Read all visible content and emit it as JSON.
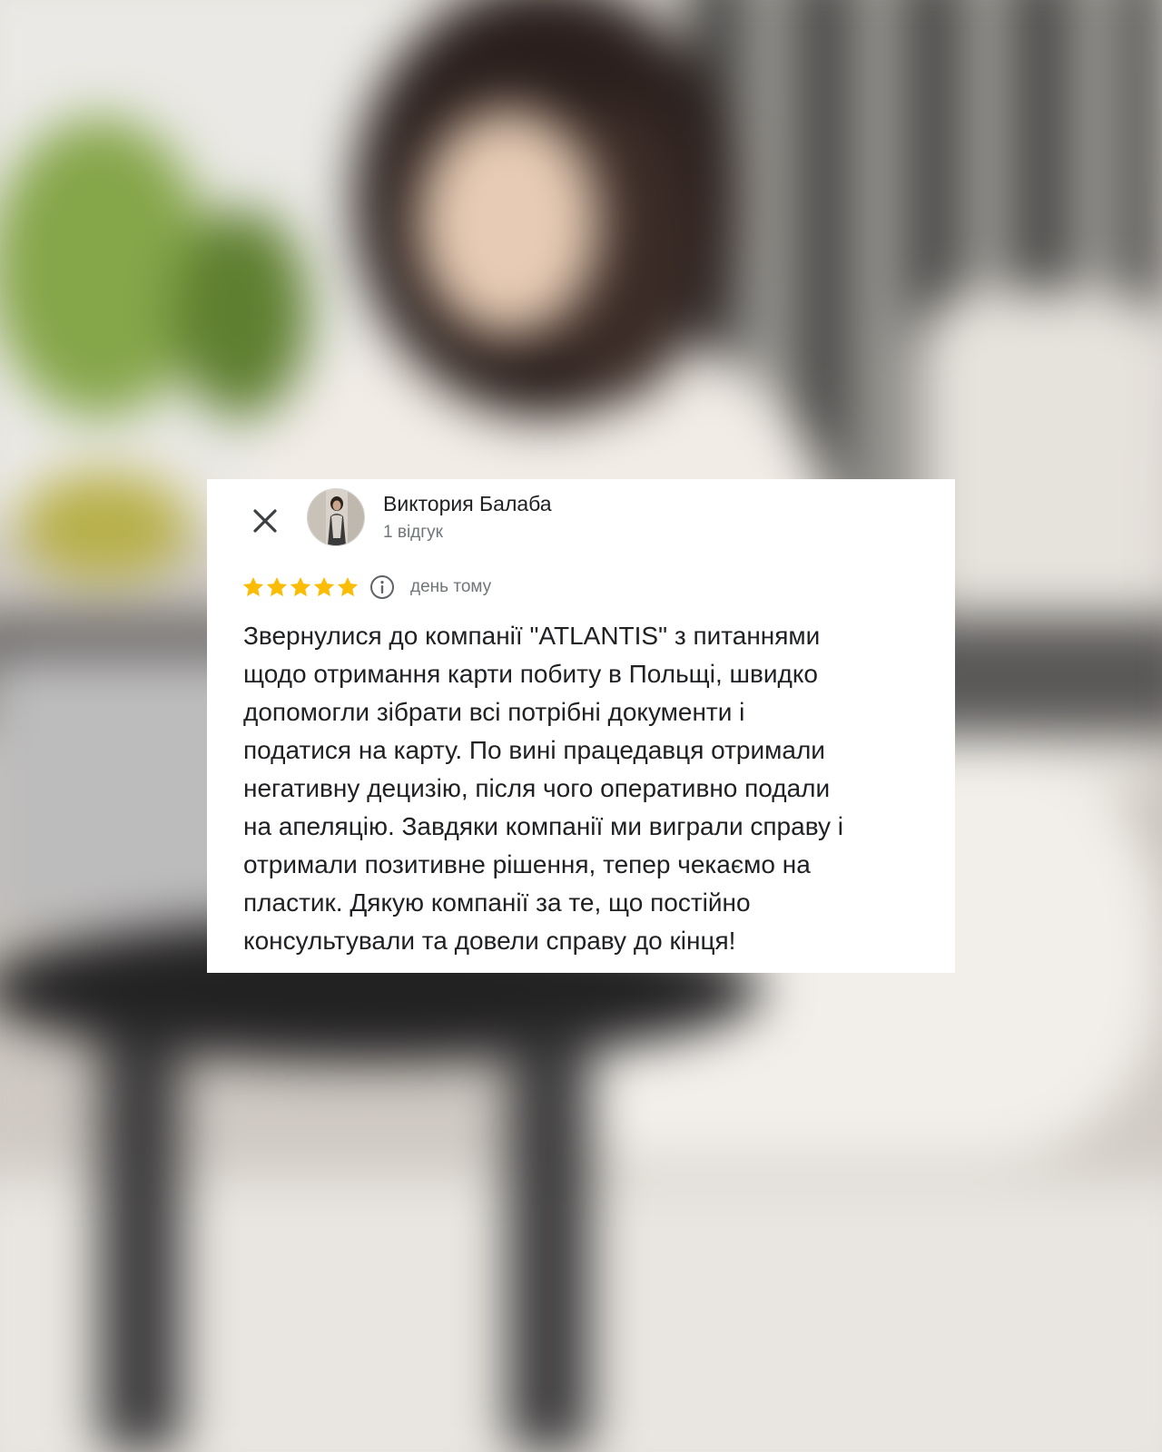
{
  "review": {
    "reviewer_name": "Виктория Балаба",
    "reviewer_meta": "1 відгук",
    "rating": 5,
    "rating_max": 5,
    "star_color": "#fbbc04",
    "date": "день тому",
    "text": "Звернулися до компанії \"ATLANTIS\" з питаннями\nщодо отримання карти побиту в Польщі, швидко\nдопомогли зібрати всі потрібні документи і\nподатися на карту. По вині працедавця отримали\nнегативну децизію, після чого оперативно подали\nна апеляцію. Завдяки компанії ми виграли справу і\nотримали позитивне рішення, тепер чекаємо на\nпластик. Дякую компанії за те, що постійно\nконсультували та довели справу до кінця!"
  },
  "icons": {
    "close": "close-icon",
    "info": "info-icon",
    "star": "star-icon"
  }
}
